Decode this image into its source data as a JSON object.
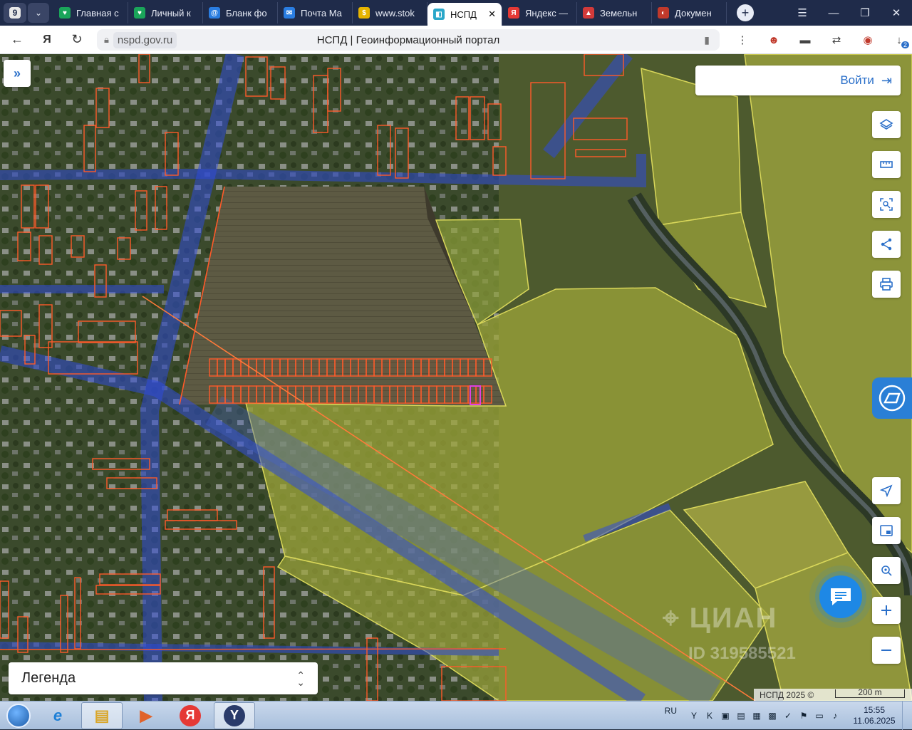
{
  "browser": {
    "tab_counter": "9",
    "tabs": [
      {
        "label": "Главная с",
        "color": "#1aa55a",
        "glyph": "♥"
      },
      {
        "label": "Личный к",
        "color": "#1aa55a",
        "glyph": "♥"
      },
      {
        "label": "Бланк фо",
        "color": "#2a7de1",
        "glyph": "@"
      },
      {
        "label": "Почта Ма",
        "color": "#2a7de1",
        "glyph": "✉"
      },
      {
        "label": "www.stok",
        "color": "#e7b400",
        "glyph": "$"
      },
      {
        "label": "НСПД",
        "color": "#2aa7c9",
        "glyph": "◧"
      },
      {
        "label": "Яндекс —",
        "color": "#e53935",
        "glyph": "Я"
      },
      {
        "label": "Земельн",
        "color": "#d23a3a",
        "glyph": "▲"
      },
      {
        "label": "Докумен",
        "color": "#c0392b",
        "glyph": "◐"
      }
    ],
    "active_tab_index": 5,
    "url_domain": "nspd.gov.ru",
    "page_title": "НСПД | Геоинформационный портал",
    "download_count": "2"
  },
  "map": {
    "login_label": "Войти",
    "legend_label": "Легенда",
    "attribution": "НСПД 2025 ©",
    "scale_label": "200 m",
    "watermark": "ЦИАН",
    "watermark_id": "ID 319585521",
    "tools": [
      "layers-icon",
      "ruler-icon",
      "select-area-icon",
      "share-icon",
      "print-icon"
    ],
    "nav_tools": [
      "locate-icon",
      "minimap-icon",
      "search-location-icon",
      "zoom-in-icon",
      "zoom-out-icon"
    ]
  },
  "taskbar": {
    "apps": [
      "explorer",
      "internet-explorer",
      "file-manager",
      "media-player",
      "yandex",
      "yandex-browser"
    ],
    "language": "RU",
    "time": "15:55",
    "date": "11.06.2025"
  }
}
